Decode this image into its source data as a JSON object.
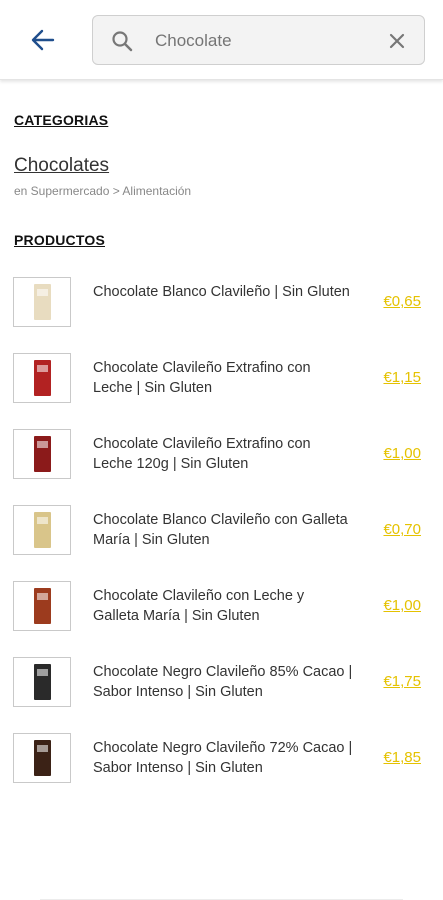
{
  "search": {
    "placeholder": "Chocolate"
  },
  "sections": {
    "categories_heading": "CATEGORIAS",
    "products_heading": "PRODUCTOS"
  },
  "category": {
    "name": "Chocolates",
    "path": "en Supermercado > Alimentación"
  },
  "products": [
    {
      "name": "Chocolate Blanco Clavileño | Sin Gluten",
      "price": "€0,65",
      "color": "#e8dcc0"
    },
    {
      "name": "Chocolate Clavileño Extrafino con Leche | Sin Gluten",
      "price": "€1,15",
      "color": "#b22222"
    },
    {
      "name": "Chocolate Clavileño Extrafino con Leche 120g | Sin Gluten",
      "price": "€1,00",
      "color": "#8b1a1a"
    },
    {
      "name": "Chocolate Blanco Clavileño con Galleta María | Sin Gluten",
      "price": "€0,70",
      "color": "#d9c58a"
    },
    {
      "name": "Chocolate Clavileño con Leche y Galleta María | Sin Gluten",
      "price": "€1,00",
      "color": "#9c3b1e"
    },
    {
      "name": "Chocolate Negro Clavileño 85% Cacao | Sabor Intenso | Sin Gluten",
      "price": "€1,75",
      "color": "#2a2a2a"
    },
    {
      "name": "Chocolate Negro Clavileño 72% Cacao | Sabor Intenso | Sin Gluten",
      "price": "€1,85",
      "color": "#3b2216"
    }
  ],
  "colors": {
    "price": "#e5c200",
    "back_arrow": "#1f4e8c"
  }
}
